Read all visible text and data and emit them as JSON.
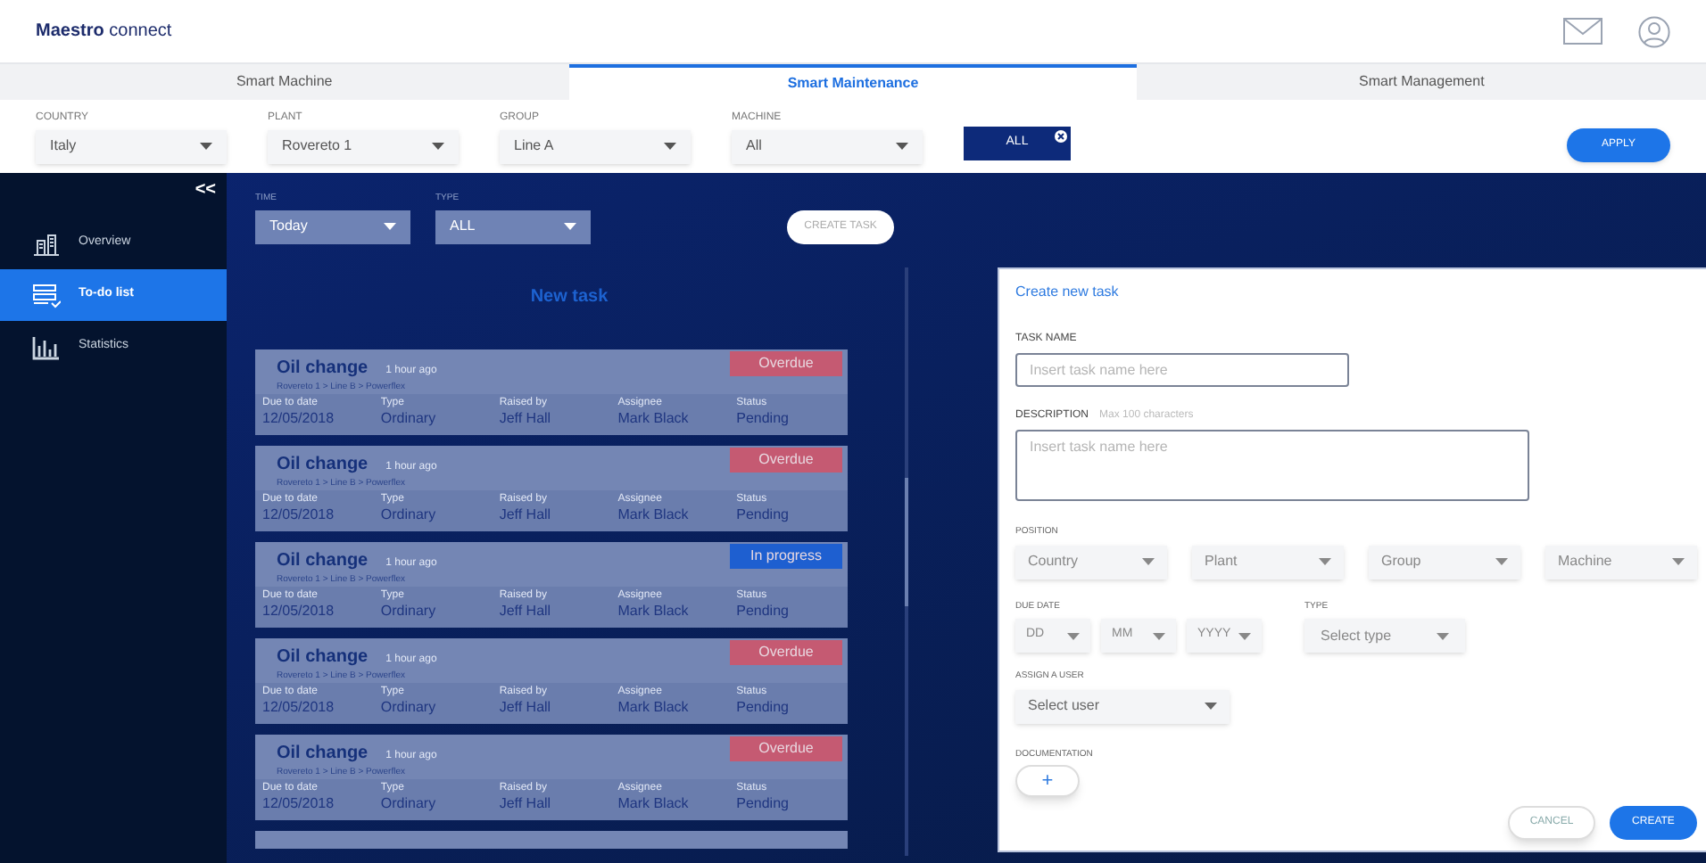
{
  "header": {
    "logo_bold": "Maestro",
    "logo_light": "connect"
  },
  "tabs": [
    {
      "label": "Smart Machine",
      "selected": false
    },
    {
      "label": "Smart Maintenance",
      "selected": true
    },
    {
      "label": "Smart Management",
      "selected": false
    }
  ],
  "filters": [
    {
      "label": "COUNTRY",
      "value": "Italy"
    },
    {
      "label": "PLANT",
      "value": "Rovereto 1"
    },
    {
      "label": "GROUP",
      "value": "Line A"
    },
    {
      "label": "MACHINE",
      "value": "All"
    }
  ],
  "chip": {
    "label": "ALL"
  },
  "apply_button": "APPLY",
  "sidebar": {
    "collapse": "<<",
    "items": [
      {
        "label": "Overview",
        "selected": false
      },
      {
        "label": "To-do list",
        "selected": true
      },
      {
        "label": "Statistics",
        "selected": false
      }
    ]
  },
  "list_filters": [
    {
      "label": "TIME",
      "value": "Today"
    },
    {
      "label": "TYPE",
      "value": "ALL"
    }
  ],
  "create_task_button": "CREATE TASK",
  "new_task_heading": "New task",
  "tasks": [
    {
      "title": "Oil change",
      "time": "1 hour ago",
      "path": "Rovereto 1 > Line B > Powerflex",
      "badge": "Overdue",
      "kind": "overdue",
      "fields": [
        {
          "label": "Due to date",
          "value": "12/05/2018"
        },
        {
          "label": "Type",
          "value": "Ordinary"
        },
        {
          "label": "Raised by",
          "value": "Jeff Hall"
        },
        {
          "label": "Assignee",
          "value": "Mark Black"
        },
        {
          "label": "Status",
          "value": "Pending"
        }
      ]
    },
    {
      "title": "Oil change",
      "time": "1 hour ago",
      "path": "Rovereto 1 > Line B > Powerflex",
      "badge": "Overdue",
      "kind": "overdue",
      "fields": [
        {
          "label": "Due to date",
          "value": "12/05/2018"
        },
        {
          "label": "Type",
          "value": "Ordinary"
        },
        {
          "label": "Raised by",
          "value": "Jeff Hall"
        },
        {
          "label": "Assignee",
          "value": "Mark Black"
        },
        {
          "label": "Status",
          "value": "Pending"
        }
      ]
    },
    {
      "title": "Oil change",
      "time": "1 hour ago",
      "path": "Rovereto 1 > Line B > Powerflex",
      "badge": "In progress",
      "kind": "progress",
      "fields": [
        {
          "label": "Due to date",
          "value": "12/05/2018"
        },
        {
          "label": "Type",
          "value": "Ordinary"
        },
        {
          "label": "Raised by",
          "value": "Jeff Hall"
        },
        {
          "label": "Assignee",
          "value": "Mark Black"
        },
        {
          "label": "Status",
          "value": "Pending"
        }
      ]
    },
    {
      "title": "Oil change",
      "time": "1 hour ago",
      "path": "Rovereto 1 > Line B > Powerflex",
      "badge": "Overdue",
      "kind": "overdue",
      "fields": [
        {
          "label": "Due to date",
          "value": "12/05/2018"
        },
        {
          "label": "Type",
          "value": "Ordinary"
        },
        {
          "label": "Raised by",
          "value": "Jeff Hall"
        },
        {
          "label": "Assignee",
          "value": "Mark Black"
        },
        {
          "label": "Status",
          "value": "Pending"
        }
      ]
    },
    {
      "title": "Oil change",
      "time": "1 hour ago",
      "path": "Rovereto 1 > Line B > Powerflex",
      "badge": "Overdue",
      "kind": "overdue",
      "fields": [
        {
          "label": "Due to date",
          "value": "12/05/2018"
        },
        {
          "label": "Type",
          "value": "Ordinary"
        },
        {
          "label": "Raised by",
          "value": "Jeff Hall"
        },
        {
          "label": "Assignee",
          "value": "Mark Black"
        },
        {
          "label": "Status",
          "value": "Pending"
        }
      ]
    }
  ],
  "form": {
    "title": "Create new task",
    "task_name": {
      "label": "TASK NAME",
      "placeholder": "Insert task name here"
    },
    "description": {
      "label": "DESCRIPTION",
      "hint": "Max 100 characters",
      "placeholder": "Insert task name here"
    },
    "position": {
      "label": "POSITION",
      "selects": [
        "Country",
        "Plant",
        "Group",
        "Machine"
      ]
    },
    "due_date": {
      "label": "DUE DATE",
      "selects": [
        "DD",
        "MM",
        "YYYY"
      ]
    },
    "type": {
      "label": "TYPE",
      "select": "Select type"
    },
    "assign": {
      "label": "ASSIGN A USER",
      "select": "Select user"
    },
    "documentation": {
      "label": "DOCUMENTATION",
      "add": "+"
    },
    "cancel": "CANCEL",
    "create": "CREATE"
  }
}
